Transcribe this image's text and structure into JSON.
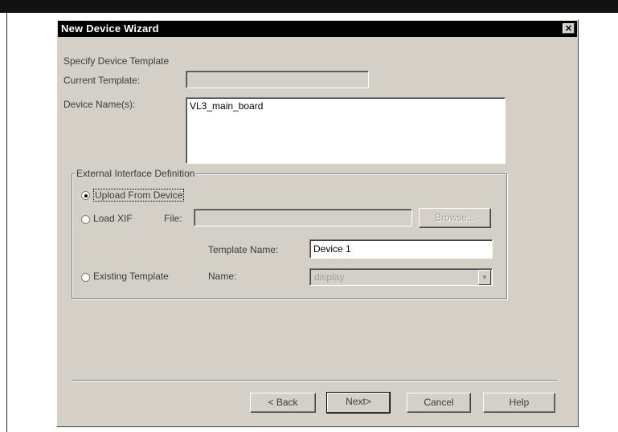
{
  "window": {
    "title": "New Device Wizard",
    "close_glyph": "✕"
  },
  "section": {
    "heading": "Specify Device Template",
    "current_template_label": "Current Template:",
    "current_template_value": "",
    "device_names_label": "Device Name(s):",
    "device_names_value": "VL3_main_board"
  },
  "external_interface": {
    "title": "External Interface Definition",
    "upload_label": "Upload From Device",
    "load_xif_label": "Load XIF",
    "file_label": "File:",
    "file_value": "",
    "browse_label": "Browse...",
    "template_name_label": "Template Name:",
    "template_name_value": "Device 1",
    "existing_template_label": "Existing Template",
    "name_label": "Name:",
    "name_value": "display",
    "selected_option": "upload"
  },
  "buttons": {
    "back": "< Back",
    "next": "Next>",
    "cancel": "Cancel",
    "help": "Help"
  },
  "icons": {
    "dropdown": "chevron-down-icon",
    "close": "close-icon"
  }
}
